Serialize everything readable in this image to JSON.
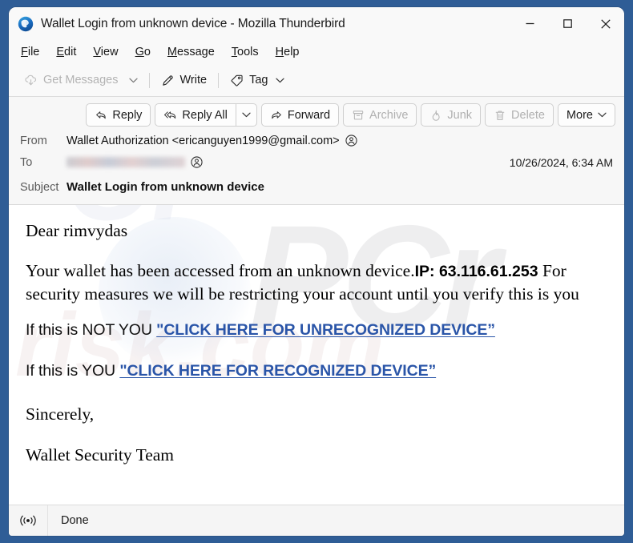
{
  "window": {
    "title": "Wallet Login from unknown device - Mozilla Thunderbird",
    "app_icon": "thunderbird-icon",
    "controls": {
      "minimize": "minimize-icon",
      "maximize": "maximize-icon",
      "close": "close-icon"
    }
  },
  "menubar": {
    "items": [
      {
        "label": "File",
        "accesskey": "F"
      },
      {
        "label": "Edit",
        "accesskey": "E"
      },
      {
        "label": "View",
        "accesskey": "V"
      },
      {
        "label": "Go",
        "accesskey": "G"
      },
      {
        "label": "Message",
        "accesskey": "M"
      },
      {
        "label": "Tools",
        "accesskey": "T"
      },
      {
        "label": "Help",
        "accesskey": "H"
      }
    ]
  },
  "toolbar": {
    "get_messages": "Get Messages",
    "get_messages_icon": "cloud-download-icon",
    "get_messages_chevron": "chevron-down-icon",
    "write": "Write",
    "write_icon": "pencil-icon",
    "tag": "Tag",
    "tag_icon": "tag-icon",
    "tag_chevron": "chevron-down-icon"
  },
  "message_actions": {
    "reply": "Reply",
    "reply_icon": "reply-arrow-icon",
    "reply_all": "Reply All",
    "reply_all_icon": "reply-all-arrow-icon",
    "reply_all_chevron": "chevron-down-icon",
    "forward": "Forward",
    "forward_icon": "forward-arrow-icon",
    "archive": "Archive",
    "archive_icon": "archive-box-icon",
    "junk": "Junk",
    "junk_icon": "flame-icon",
    "delete": "Delete",
    "delete_icon": "trash-icon",
    "more": "More",
    "more_chevron": "chevron-down-icon"
  },
  "headers": {
    "from_label": "From",
    "from_value": "Wallet Authorization <ericanguyen1999@gmail.com>",
    "from_avatar_icon": "contact-circle-icon",
    "to_label": "To",
    "to_value": "",
    "to_redacted": true,
    "to_avatar_icon": "contact-circle-icon",
    "date": "10/26/2024, 6:34 AM",
    "subject_label": "Subject",
    "subject_value": "Wallet Login from unknown device"
  },
  "body": {
    "greeting": "Dear  rimvydas",
    "paragraph_part1": "Your wallet has been accessed from an unknown device.",
    "paragraph_ip": "IP: 63.116.61.253",
    "paragraph_part2": " For security measures we will be restricting your account until you verify this is you",
    "not_you_prefix": "If this is NOT YOU ",
    "not_you_link": "\"CLICK HERE FOR UNRECOGNIZED DEVICE”",
    "is_you_prefix": "If this is YOU  ",
    "is_you_link": "\"CLICK HERE FOR RECOGNIZED DEVICE”",
    "signoff": "Sincerely,",
    "signature": "Wallet Security Team",
    "link_color": "#2a55a8"
  },
  "watermark": {
    "line_a": "PCr",
    "line_b": "risk.com"
  },
  "statusbar": {
    "icon": "broadcast-icon",
    "text": "Done"
  },
  "colors": {
    "desktop": "#2f5d96",
    "chrome": "#f9f9f9",
    "header_pane": "#f7f7f7",
    "accent_link": "#2a55a8"
  }
}
